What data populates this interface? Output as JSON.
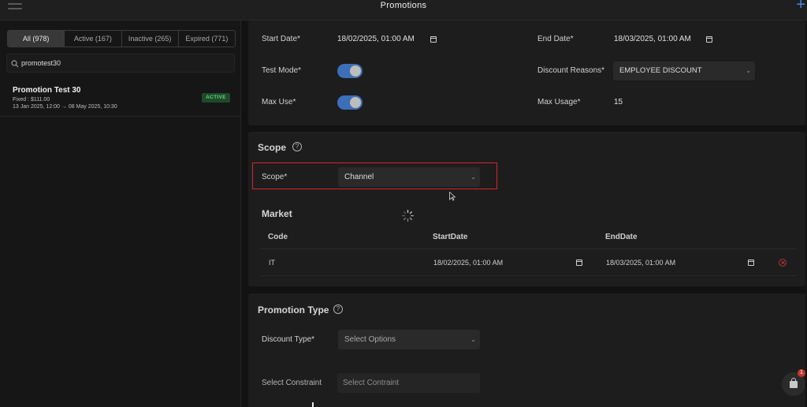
{
  "header": {
    "title": "Promotions",
    "add_label": "+"
  },
  "filters": {
    "tabs": [
      {
        "label": "All (978)",
        "selected": true
      },
      {
        "label": "Active (167)",
        "selected": false
      },
      {
        "label": "Inactive (265)",
        "selected": false
      },
      {
        "label": "Expired (771)",
        "selected": false
      }
    ],
    "search_value": "promotest30"
  },
  "promotions": [
    {
      "name": "Promotion Test 30",
      "value_line": "Fixed : $111.00",
      "date_line": "13 Jan 2025, 12:00 → 08 May 2025, 10:30",
      "status": "ACTIVE"
    }
  ],
  "general": {
    "start_date_label": "Start Date*",
    "start_date_value": "18/02/2025, 01:00 AM",
    "end_date_label": "End Date*",
    "end_date_value": "18/03/2025, 01:00 AM",
    "test_mode_label": "Test Mode*",
    "test_mode_on": true,
    "discount_reasons_label": "Discount Reasons*",
    "discount_reasons_value": "EMPLOYEE DISCOUNT",
    "max_use_label": "Max Use*",
    "max_use_on": true,
    "max_usage_label": "Max Usage*",
    "max_usage_value": "15"
  },
  "scope": {
    "title": "Scope",
    "label": "Scope*",
    "value": "Channel"
  },
  "market": {
    "title": "Market",
    "columns": [
      "Code",
      "StartDate",
      "EndDate"
    ],
    "rows": [
      {
        "code": "IT",
        "start": "18/02/2025, 01:00 AM",
        "end": "18/03/2025, 01:00 AM"
      }
    ]
  },
  "promotion_type": {
    "title": "Promotion Type",
    "discount_type_label": "Discount Type*",
    "discount_type_placeholder": "Select Options",
    "constraint_label": "Select Constraint",
    "constraint_placeholder": "Select Contraint"
  },
  "cart": {
    "badge": "1"
  },
  "colors": {
    "accent": "#3f8ce8",
    "toggle_on": "#3d6fb8",
    "active_badge_bg": "#1f4a2a",
    "active_badge_text": "#63d182",
    "highlight_border": "#d4262b",
    "remove_icon": "#b5333a"
  }
}
